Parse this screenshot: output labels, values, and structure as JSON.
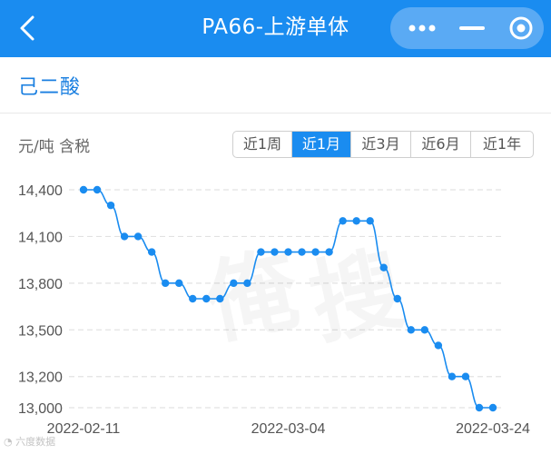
{
  "header": {
    "title": "PA66-上游单体",
    "back_icon": "back-chevron-icon",
    "more_icon": "more-dots-icon",
    "minimize_icon": "minimize-icon",
    "close_icon": "target-close-icon",
    "bar_color": "#1a8cf0"
  },
  "section": {
    "title": "己二酸"
  },
  "unit_label": "元/吨 含税",
  "period_tabs": [
    {
      "label": "近1周",
      "active": false
    },
    {
      "label": "近1月",
      "active": true
    },
    {
      "label": "近3月",
      "active": false
    },
    {
      "label": "近6月",
      "active": false
    },
    {
      "label": "近1年",
      "active": false
    }
  ],
  "chart_data": {
    "type": "line",
    "title": "",
    "xlabel": "",
    "ylabel": "元/吨 含税",
    "ylim": [
      13000,
      14400
    ],
    "y_ticks": [
      14400,
      14100,
      13800,
      13500,
      13200,
      13000
    ],
    "y_tick_labels": [
      "14,400",
      "14,100",
      "13,800",
      "13,500",
      "13,200",
      "13,000"
    ],
    "x_tick_labels": [
      "2022-02-11",
      "2022-03-04",
      "2022-03-24"
    ],
    "grid": true,
    "line_color": "#1a8cf0",
    "series": [
      {
        "values": [
          14400,
          14400,
          14300,
          14100,
          14100,
          14000,
          13800,
          13800,
          13700,
          13700,
          13700,
          13800,
          13800,
          14000,
          14000,
          14000,
          14000,
          14000,
          14000,
          14200,
          14200,
          14200,
          13900,
          13700,
          13500,
          13500,
          13400,
          13200,
          13200,
          13000,
          13000
        ]
      }
    ]
  },
  "watermark": "俺搜",
  "footer": {
    "logo_text": "六度数据"
  }
}
